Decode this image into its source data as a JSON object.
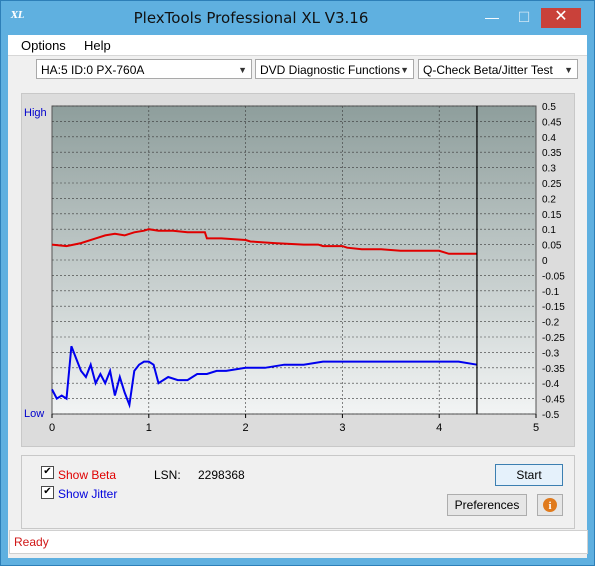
{
  "window": {
    "title": "PlexTools Professional XL V3.16",
    "icon": "XL",
    "minimize": "—",
    "maximize": "☐",
    "close": "✕"
  },
  "menu": {
    "options": "Options",
    "help": "Help"
  },
  "toolbar": {
    "drive": "HA:5 ID:0  PX-760A",
    "function": "DVD Diagnostic Functions",
    "test": "Q-Check Beta/Jitter Test"
  },
  "chart_data": {
    "type": "line",
    "y_left_labels": {
      "high": "High",
      "low": "Low"
    },
    "x_ticks": [
      "0",
      "1",
      "2",
      "3",
      "4",
      "5"
    ],
    "xlim": [
      0,
      5
    ],
    "y_right_ticks": [
      "0.5",
      "0.45",
      "0.4",
      "0.35",
      "0.3",
      "0.25",
      "0.2",
      "0.15",
      "0.1",
      "0.05",
      "0",
      "-0.05",
      "-0.1",
      "-0.15",
      "-0.2",
      "-0.25",
      "-0.3",
      "-0.35",
      "-0.4",
      "-0.45",
      "-0.5"
    ],
    "ylim": [
      -0.5,
      0.5
    ],
    "end_marker_x": 4.39,
    "grid": true,
    "colors": {
      "beta": "#e00000",
      "jitter": "#0000ee",
      "bg": "#8e9e9c"
    },
    "series": [
      {
        "key": "beta",
        "x": [
          0,
          0.15,
          0.3,
          0.45,
          0.55,
          0.65,
          0.75,
          0.85,
          0.95,
          1.0,
          1.1,
          1.25,
          1.4,
          1.55,
          1.58,
          1.6,
          1.75,
          2.0,
          2.05,
          2.3,
          2.6,
          2.75,
          2.8,
          3.0,
          3.05,
          3.2,
          3.4,
          3.6,
          3.8,
          4.0,
          4.1,
          4.3,
          4.39
        ],
        "y": [
          0.05,
          0.045,
          0.055,
          0.07,
          0.08,
          0.085,
          0.08,
          0.09,
          0.095,
          0.1,
          0.095,
          0.095,
          0.09,
          0.09,
          0.09,
          0.07,
          0.07,
          0.065,
          0.06,
          0.055,
          0.05,
          0.05,
          0.045,
          0.045,
          0.04,
          0.035,
          0.035,
          0.03,
          0.03,
          0.03,
          0.02,
          0.02,
          0.02
        ]
      },
      {
        "key": "jitter",
        "x": [
          0,
          0.05,
          0.1,
          0.15,
          0.18,
          0.2,
          0.25,
          0.3,
          0.35,
          0.4,
          0.45,
          0.5,
          0.55,
          0.6,
          0.65,
          0.7,
          0.75,
          0.8,
          0.85,
          0.9,
          0.95,
          1.0,
          1.05,
          1.1,
          1.15,
          1.2,
          1.3,
          1.4,
          1.5,
          1.6,
          1.7,
          1.8,
          2.0,
          2.2,
          2.4,
          2.6,
          2.8,
          3.0,
          3.2,
          3.4,
          3.6,
          3.8,
          4.0,
          4.2,
          4.39
        ],
        "y": [
          -0.42,
          -0.45,
          -0.44,
          -0.45,
          -0.35,
          -0.28,
          -0.32,
          -0.36,
          -0.38,
          -0.34,
          -0.4,
          -0.37,
          -0.4,
          -0.36,
          -0.44,
          -0.38,
          -0.43,
          -0.47,
          -0.36,
          -0.34,
          -0.33,
          -0.33,
          -0.34,
          -0.4,
          -0.39,
          -0.38,
          -0.39,
          -0.39,
          -0.37,
          -0.37,
          -0.36,
          -0.36,
          -0.35,
          -0.35,
          -0.34,
          -0.34,
          -0.33,
          -0.33,
          -0.33,
          -0.33,
          -0.33,
          -0.33,
          -0.33,
          -0.33,
          -0.34
        ]
      }
    ]
  },
  "controls": {
    "show_beta": "Show Beta",
    "show_jitter": "Show Jitter",
    "beta_checked": "✔",
    "jitter_checked": "✔",
    "lsn_label": "LSN:",
    "lsn_value": "2298368",
    "start": "Start",
    "preferences": "Preferences",
    "info_icon": "info-icon"
  },
  "status": {
    "text": "Ready"
  }
}
